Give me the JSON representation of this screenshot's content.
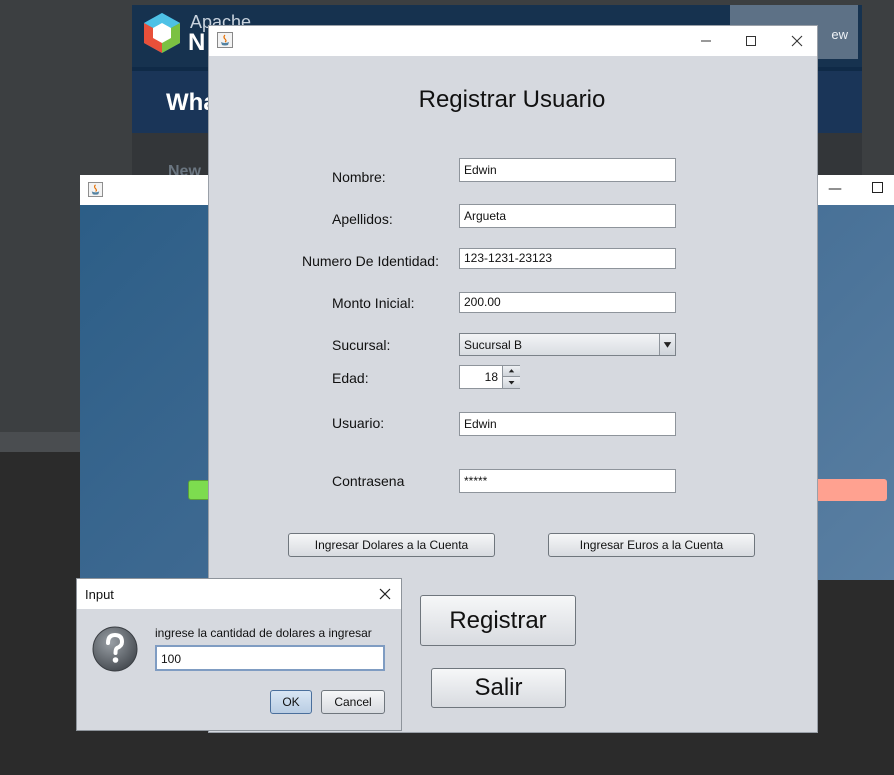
{
  "background": {
    "netbeans": {
      "brand_top": "Apache",
      "brand_bottom": "N",
      "corner_button_label": "ew",
      "heading_partial": "Wha",
      "news_partial": "New"
    }
  },
  "main_window": {
    "title": "Registrar Usuario",
    "fields": {
      "nombre": {
        "label": "Nombre:",
        "value": "Edwin"
      },
      "apellidos": {
        "label": "Apellidos:",
        "value": "Argueta"
      },
      "identidad": {
        "label": "Numero De Identidad:",
        "value": "123-1231-23123"
      },
      "monto": {
        "label": "Monto Inicial:",
        "value": "200.00"
      },
      "sucursal": {
        "label": "Sucursal:",
        "value": "Sucursal B"
      },
      "edad": {
        "label": "Edad:",
        "value": "18"
      },
      "usuario": {
        "label": "Usuario:",
        "value": "Edwin"
      },
      "contrasena": {
        "label": "Contrasena",
        "value": "*****"
      }
    },
    "buttons": {
      "dolares": "Ingresar Dolares a la Cuenta",
      "euros": "Ingresar Euros a la Cuenta",
      "registrar": "Registrar",
      "salir": "Salir"
    }
  },
  "input_dialog": {
    "title": "Input",
    "message": "ingrese la cantidad de dolares a ingresar",
    "value": "100",
    "ok_label": "OK",
    "cancel_label": "Cancel"
  },
  "colors": {
    "dialog_bg": "#d6d9df",
    "accent_green": "#7ddc4f",
    "accent_salmon": "#ffa190"
  }
}
